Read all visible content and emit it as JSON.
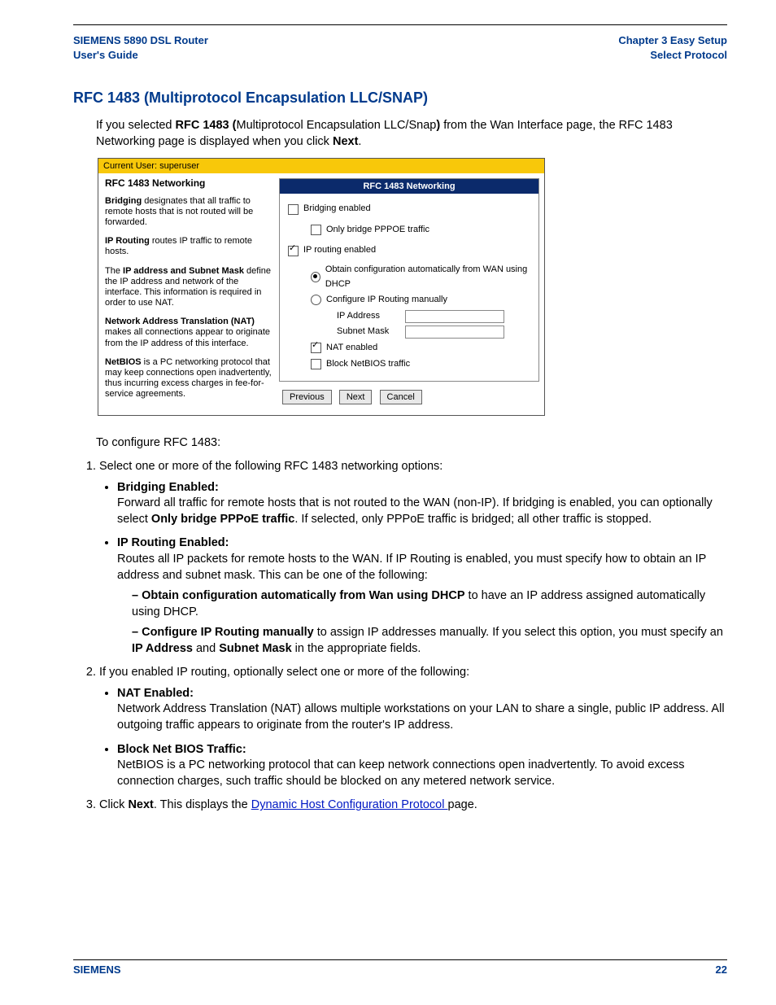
{
  "header": {
    "left_line1": "SIEMENS 5890 DSL Router",
    "left_line2": "User's Guide",
    "right_line1": "Chapter 3  Easy Setup",
    "right_line2": "Select Protocol"
  },
  "section_title": "RFC 1483 (Multiprotocol Encapsulation LLC/SNAP)",
  "intro": {
    "pre": "If you selected ",
    "b1": "RFC 1483 (",
    "mid1": "Multiprotocol Encapsulation LLC/Snap",
    "b2": ")",
    "mid2": " from the Wan Interface page, the RFC 1483 Networking page is displayed when you click ",
    "b3": "Next",
    "end": "."
  },
  "screenshot": {
    "current_user": "Current User: superuser",
    "left": {
      "title": "RFC 1483 Networking",
      "p1_b": "Bridging",
      "p1": " designates that all traffic to remote hosts that is not routed will be forwarded.",
      "p2_b": "IP Routing",
      "p2": " routes IP traffic to remote hosts.",
      "p3a": "The ",
      "p3_b": "IP address and Subnet Mask",
      "p3b": " define the IP address and network of the interface. This information is required in order to use NAT.",
      "p4_b": "Network Address Translation (NAT)",
      "p4": " makes all connections appear to originate from the IP address of this interface.",
      "p5_b": "NetBIOS",
      "p5": " is a PC networking protocol that may keep connections open inadvertently, thus incurring excess charges in fee-for-service agreements."
    },
    "panel_title": "RFC 1483 Networking",
    "bridging_enabled": "Bridging enabled",
    "only_bridge": "Only bridge PPPOE traffic",
    "ip_routing": "IP routing enabled",
    "obtain_dhcp": "Obtain configuration automatically from WAN using DHCP",
    "configure_manual": "Configure IP Routing manually",
    "ip_address_lbl": "IP Address",
    "subnet_lbl": "Subnet Mask",
    "nat_enabled": "NAT enabled",
    "block_netbios": "Block NetBIOS traffic",
    "btn_prev": "Previous",
    "btn_next": "Next",
    "btn_cancel": "Cancel"
  },
  "configure_lead": "To configure RFC 1483:",
  "ol": {
    "li1": "Select one or more of the following RFC 1483 networking options:",
    "li1_b1_h": "Bridging Enabled:",
    "li1_b1_t1": "Forward all traffic for remote hosts that is not routed to the WAN (non-IP). If bridging is enabled, you can optionally select ",
    "li1_b1_bold": "Only bridge PPPoE traffic",
    "li1_b1_t2": ". If selected, only PPPoE traffic is bridged; all other traffic is stopped.",
    "li1_b2_h": "IP Routing Enabled:",
    "li1_b2_t": "Routes all IP packets for remote hosts to the WAN. If IP Routing is enabled, you must specify how to obtain an IP address and subnet mask. This can be one of the following:",
    "li1_b2_d1_b": "Obtain configuration automatically from Wan using DHCP",
    "li1_b2_d1_t": " to have an IP address assigned automatically using DHCP.",
    "li1_b2_d2_b": "Configure IP Routing manually",
    "li1_b2_d2_t1": " to assign IP addresses manually. If you select this option, you must specify an ",
    "li1_b2_d2_b2": "IP Address",
    "li1_b2_d2_t2": " and ",
    "li1_b2_d2_b3": "Subnet Mask",
    "li1_b2_d2_t3": " in the appropriate fields.",
    "li2": "If you enabled IP routing, optionally select one or more of the following:",
    "li2_b1_h": "NAT Enabled:",
    "li2_b1_t": "Network Address Translation (NAT) allows multiple workstations on your LAN to share a single, public IP address. All outgoing traffic appears to originate from the router's IP address.",
    "li2_b2_h": "Block Net BIOS Traffic:",
    "li2_b2_t": "NetBIOS is a PC networking protocol that can keep network connections open inadvertently. To avoid excess connection charges, such traffic should be blocked on any metered network service.",
    "li3_t1": "Click ",
    "li3_b": "Next",
    "li3_t2": ". This displays the ",
    "li3_link": "Dynamic Host Configuration Protocol ",
    "li3_t3": "page."
  },
  "footer": {
    "left": "SIEMENS",
    "right": "22"
  }
}
